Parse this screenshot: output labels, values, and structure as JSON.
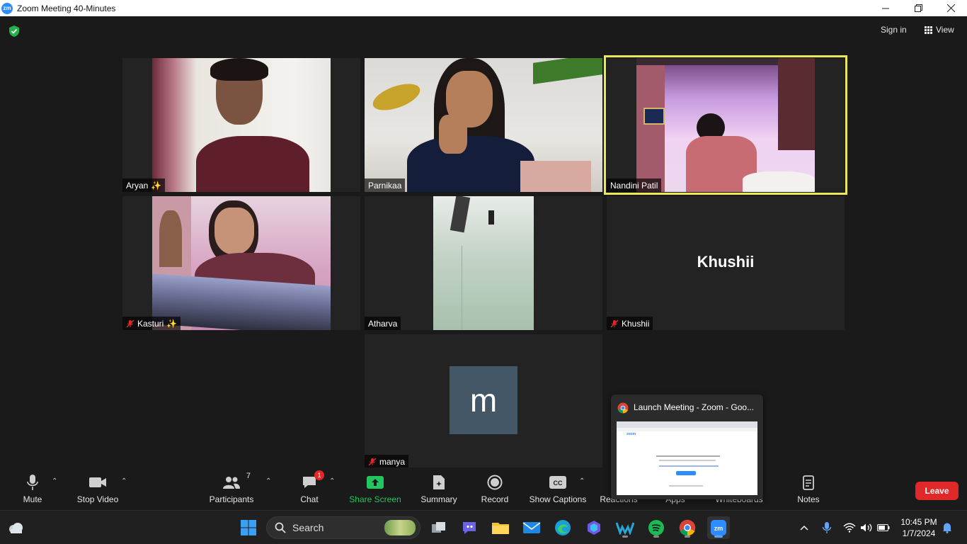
{
  "window": {
    "title": "Zoom Meeting 40-Minutes",
    "logo_text": "zm"
  },
  "header": {
    "sign_in": "Sign in",
    "view": "View"
  },
  "participants": {
    "aryan": "Aryan",
    "parnikaa": "Parnikaa",
    "nandini": "Nandini Patil",
    "kasturi": "Kasturi",
    "atharva": "Atharva",
    "khushii": "Khushii",
    "khushii_big": "Khushii",
    "manya": "manya",
    "manya_initial": "m"
  },
  "toolbar": {
    "mute": "Mute",
    "stop_video": "Stop Video",
    "participants": "Participants",
    "participants_count": "7",
    "chat": "Chat",
    "chat_badge": "1",
    "share_screen": "Share Screen",
    "summary": "Summary",
    "record": "Record",
    "show_captions": "Show Captions",
    "reactions": "Reactions",
    "apps": "Apps",
    "whiteboards": "Whiteboards",
    "notes": "Notes",
    "leave": "Leave"
  },
  "popup": {
    "title": "Launch Meeting - Zoom - Goo...",
    "thumb_brand": "zoom"
  },
  "taskbar": {
    "search_placeholder": "Search",
    "time": "10:45 PM",
    "date": "1/7/2024"
  },
  "colors": {
    "active_speaker": "#e8e85a",
    "leave": "#e02828",
    "share_green": "#22c55e",
    "zoom_blue": "#2d8cff"
  }
}
